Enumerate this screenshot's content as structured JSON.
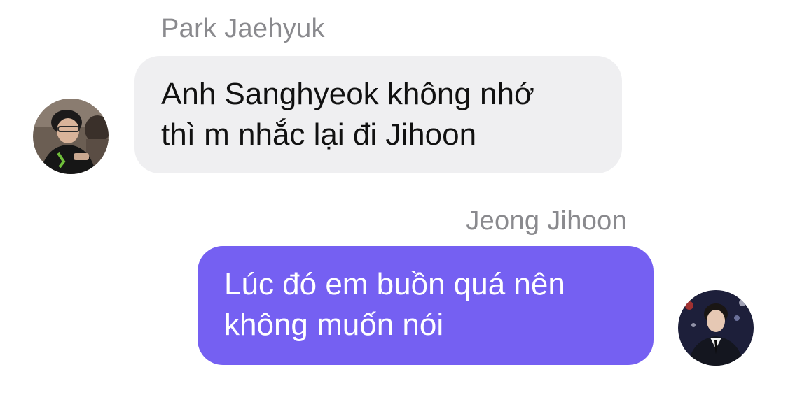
{
  "messages": [
    {
      "sender": "Park Jaehyuk",
      "lines": [
        "Anh Sanghyeok không nhớ",
        "thì m nhắc lại đi Jihoon"
      ],
      "side": "left",
      "bubble_color": "#efeff1",
      "avatar": "avatar-photo-park-jaehyuk"
    },
    {
      "sender": "Jeong Jihoon",
      "lines": [
        "Lúc đó em buồn quá nên",
        "không muốn nói"
      ],
      "side": "right",
      "bubble_color": "#7560f2",
      "avatar": "avatar-photo-jeong-jihoon"
    }
  ]
}
